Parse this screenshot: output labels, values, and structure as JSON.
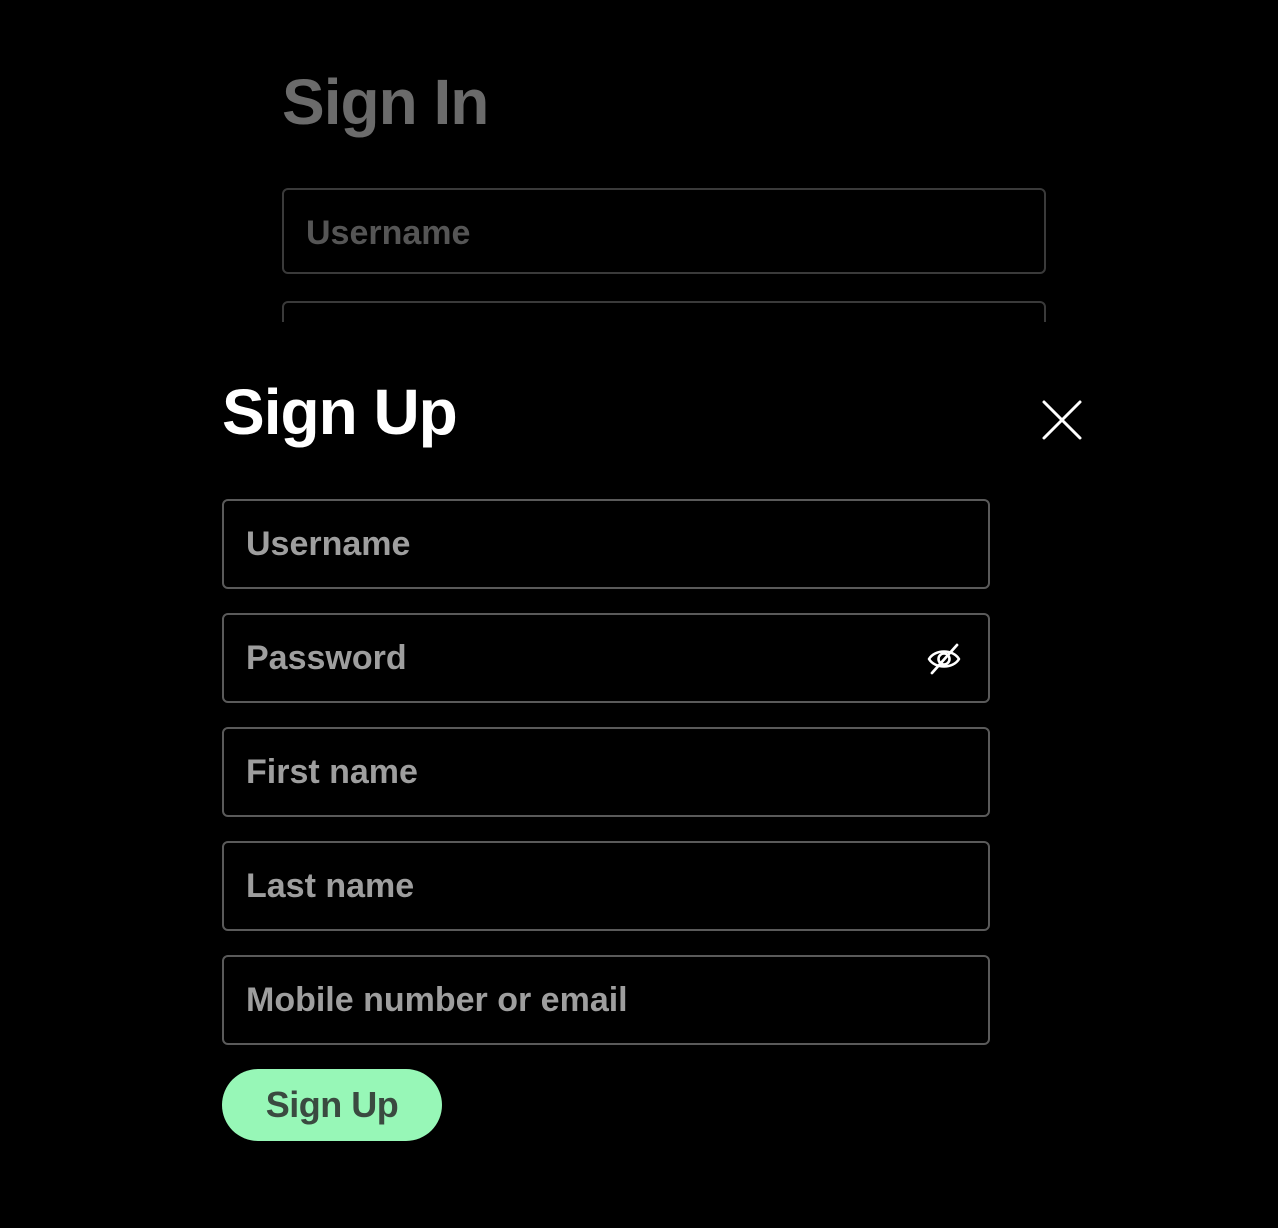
{
  "signin": {
    "title": "Sign In",
    "username_placeholder": "Username"
  },
  "signup": {
    "title": "Sign Up",
    "close_icon": "close-icon",
    "fields": {
      "username": "Username",
      "password": "Password",
      "first_name": "First name",
      "last_name": "Last name",
      "contact": "Mobile number or email"
    },
    "password_toggle_icon": "eye-off-icon",
    "submit_label": "Sign Up",
    "submit_color": "#97f7b7"
  }
}
